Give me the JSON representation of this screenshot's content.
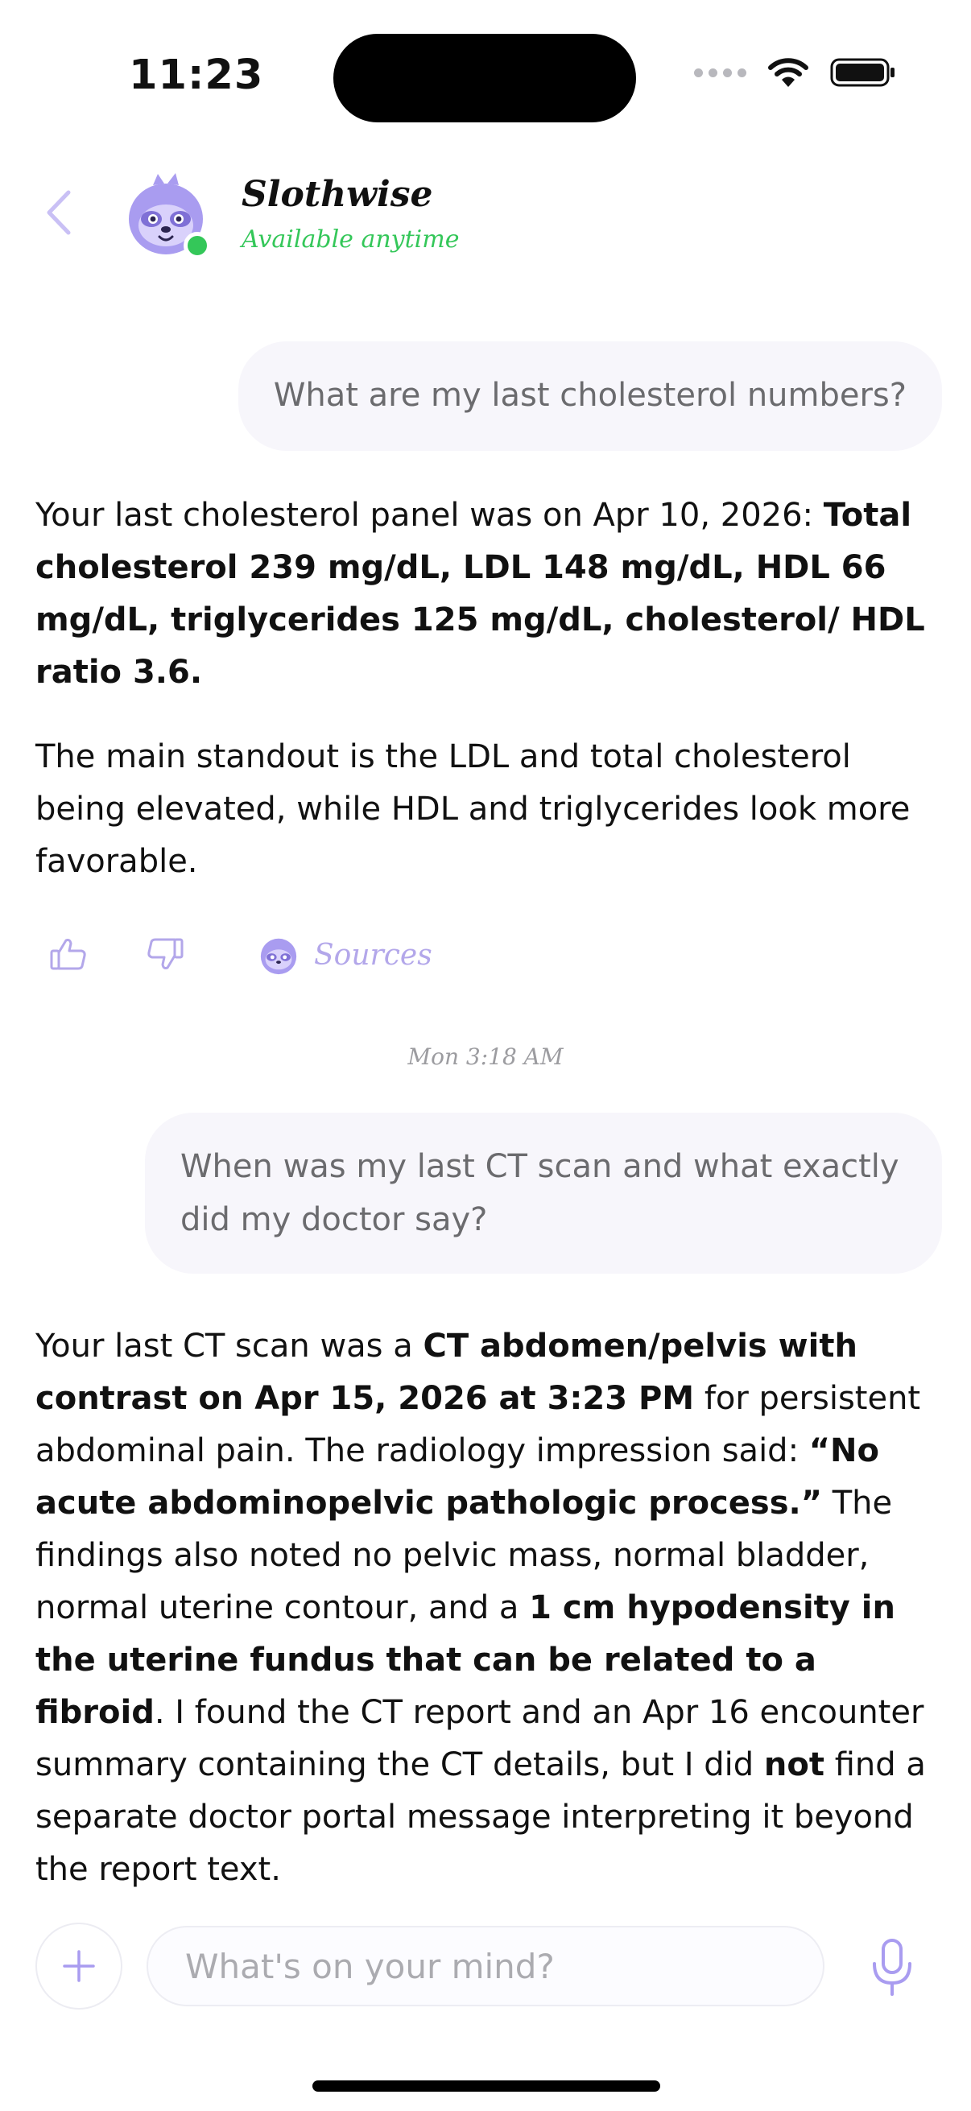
{
  "status_bar": {
    "time": "11:23"
  },
  "header": {
    "bot_name": "Slothwise",
    "bot_status": "Available anytime",
    "avatar_icon": "sloth-avatar-icon",
    "status_color": "#34c759"
  },
  "messages": {
    "user_1": "What are my last cholesterol numbers?",
    "bot_1": {
      "p1_intro": "Your last cholesterol panel was on Apr 10, 2026: ",
      "p1_bold": "Total cholesterol 239 mg/dL, LDL 148 mg/dL, HDL 66 mg/dL, triglycerides 125 mg/dL, cholesterol/ HDL ratio 3.6.",
      "p2": "The main standout is the LDL and total cholesterol being elevated, while HDL and triglycerides look more favorable."
    },
    "feedback": {
      "sources_label": "Sources"
    },
    "timestamp": "Mon 3:18 AM",
    "user_2": "When was my last CT scan and what exactly did my doctor say?",
    "bot_2": {
      "t1": "Your last CT scan was a ",
      "b1": "CT abdomen/pelvis with contrast on Apr 15, 2026 at 3:23 PM",
      "t2": " for persistent abdominal pain. The radiology impression said: ",
      "b2": "“No acute abdominopelvic pathologic process.”",
      "t3": " The findings also noted no pelvic mass, normal bladder, normal uterine contour, and a ",
      "b3": "1 cm hypodensity in the uterine fundus that can be related to a fibroid",
      "t4": ". I found the CT report and an Apr 16 encounter summary containing the CT details, but I did ",
      "b4": "not",
      "t5": " find a separate doctor portal message interpreting it beyond the report text."
    }
  },
  "composer": {
    "placeholder": "What's on your mind?"
  },
  "colors": {
    "accent": "#a99cf0",
    "accent_light": "#c9c0f5",
    "bubble": "#f7f6fb"
  }
}
